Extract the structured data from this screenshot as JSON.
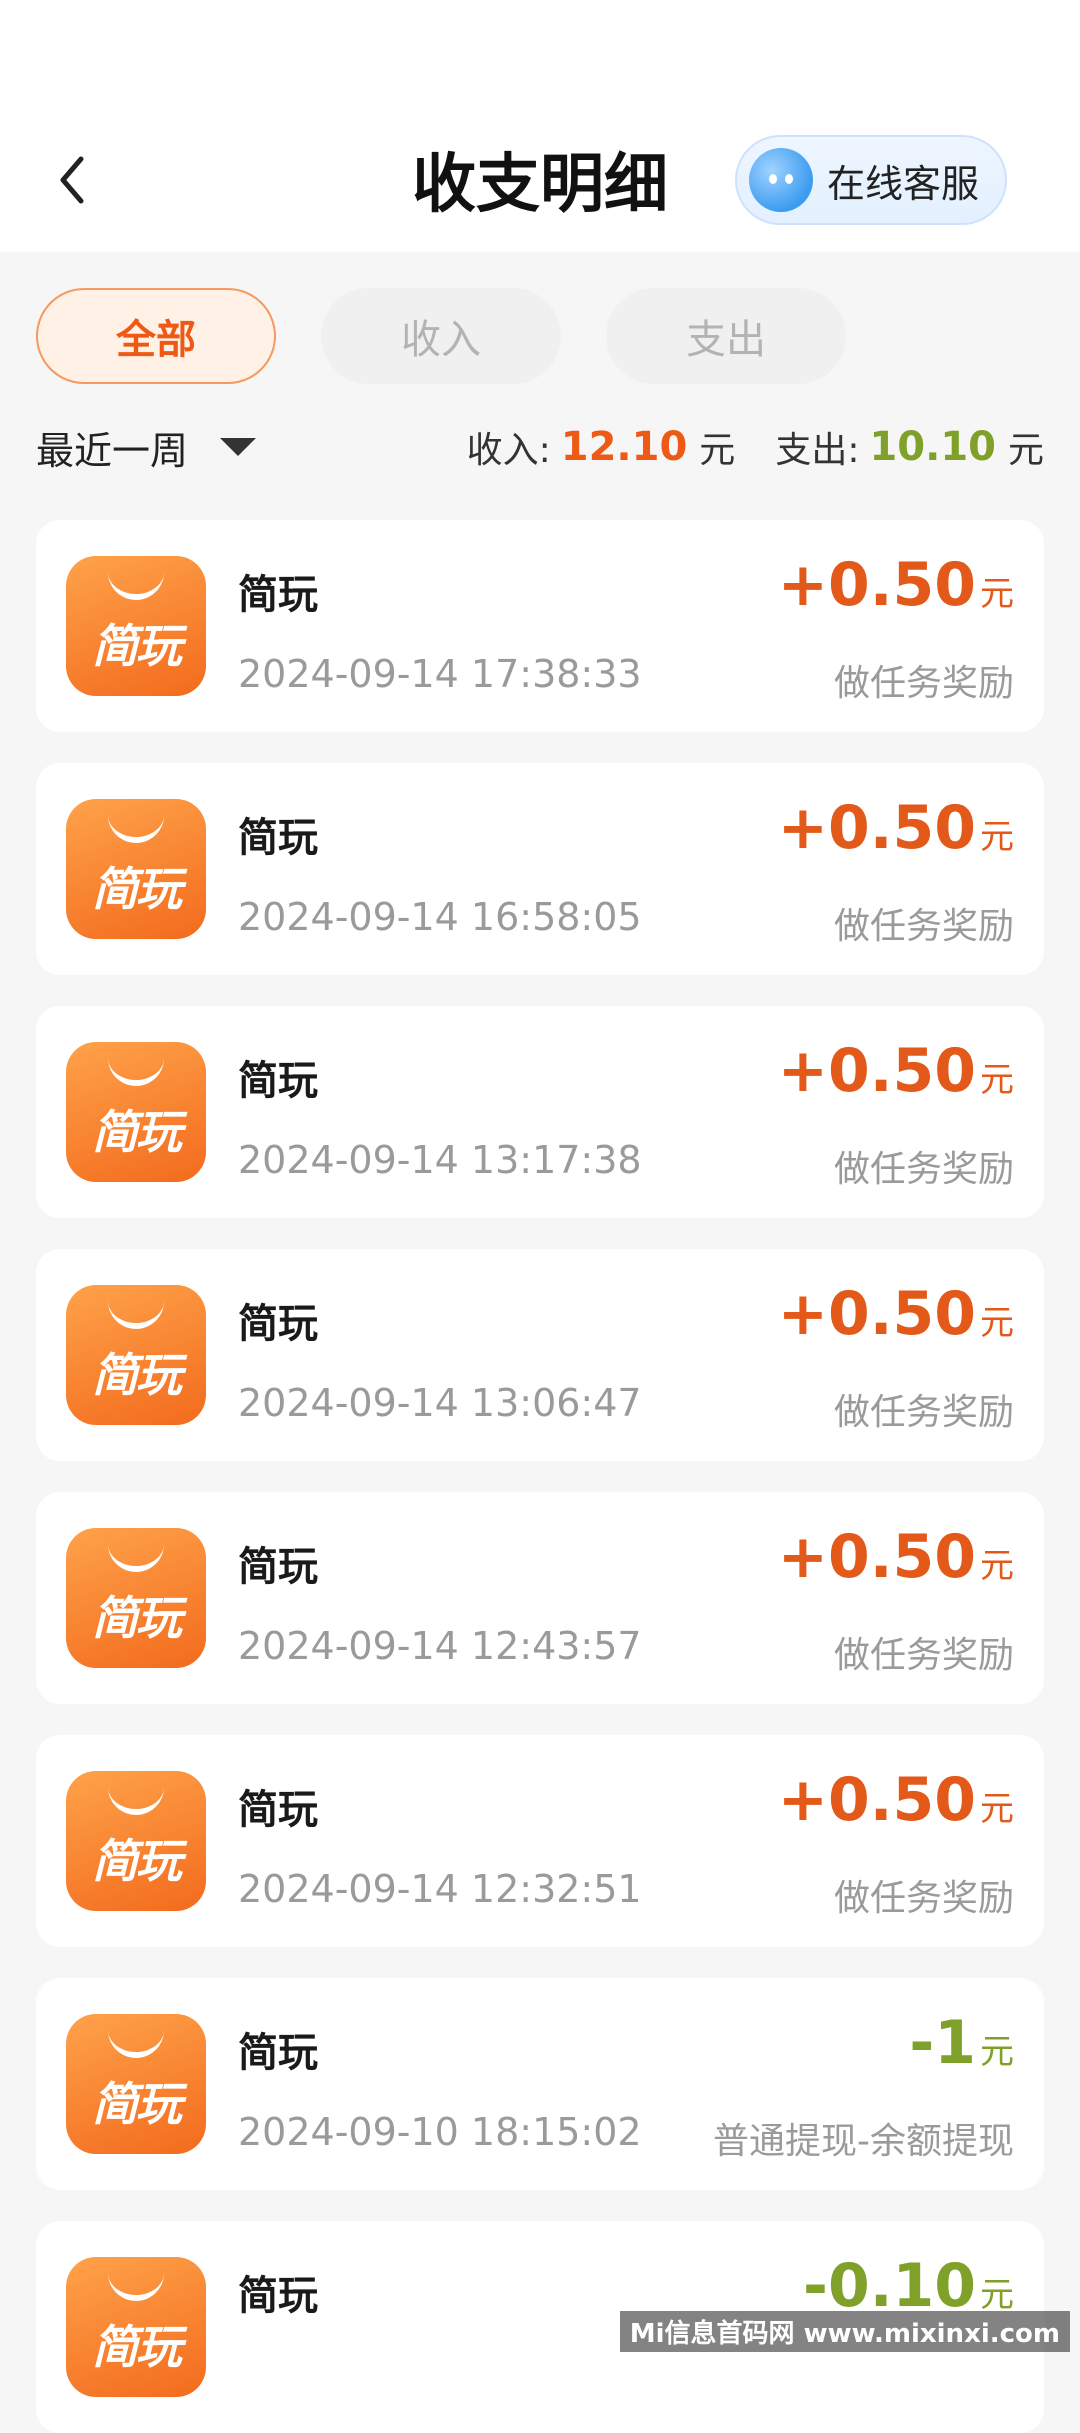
{
  "header": {
    "title": "收支明细",
    "service_label": "在线客服"
  },
  "tabs": [
    {
      "label": "全部",
      "active": true
    },
    {
      "label": "收入",
      "active": false
    },
    {
      "label": "支出",
      "active": false
    }
  ],
  "filter": {
    "period": "最近一周",
    "income_label": "收入:",
    "income_value": "12.10",
    "income_unit": "元",
    "expense_label": "支出:",
    "expense_value": "10.10",
    "expense_unit": "元"
  },
  "colors": {
    "accent": "#ee5a16",
    "income": "#e3591a",
    "expense": "#7fa12a",
    "muted": "#9a9a9a"
  },
  "transactions": [
    {
      "app_name": "简玩",
      "icon_text": "简玩",
      "time": "2024-09-14 17:38:33",
      "amount": "+0.50",
      "unit": "元",
      "desc": "做任务奖励",
      "type": "income"
    },
    {
      "app_name": "简玩",
      "icon_text": "简玩",
      "time": "2024-09-14 16:58:05",
      "amount": "+0.50",
      "unit": "元",
      "desc": "做任务奖励",
      "type": "income"
    },
    {
      "app_name": "简玩",
      "icon_text": "简玩",
      "time": "2024-09-14 13:17:38",
      "amount": "+0.50",
      "unit": "元",
      "desc": "做任务奖励",
      "type": "income"
    },
    {
      "app_name": "简玩",
      "icon_text": "简玩",
      "time": "2024-09-14 13:06:47",
      "amount": "+0.50",
      "unit": "元",
      "desc": "做任务奖励",
      "type": "income"
    },
    {
      "app_name": "简玩",
      "icon_text": "简玩",
      "time": "2024-09-14 12:43:57",
      "amount": "+0.50",
      "unit": "元",
      "desc": "做任务奖励",
      "type": "income"
    },
    {
      "app_name": "简玩",
      "icon_text": "简玩",
      "time": "2024-09-14 12:32:51",
      "amount": "+0.50",
      "unit": "元",
      "desc": "做任务奖励",
      "type": "income"
    },
    {
      "app_name": "简玩",
      "icon_text": "简玩",
      "time": "2024-09-10 18:15:02",
      "amount": "-1",
      "unit": "元",
      "desc": "普通提现-余额提现",
      "type": "expense"
    },
    {
      "app_name": "简玩",
      "icon_text": "简玩",
      "time": "",
      "amount": "-0.10",
      "unit": "元",
      "desc": "",
      "type": "expense"
    }
  ],
  "watermark": "Mi信息首码网 www.mixinxi.com"
}
